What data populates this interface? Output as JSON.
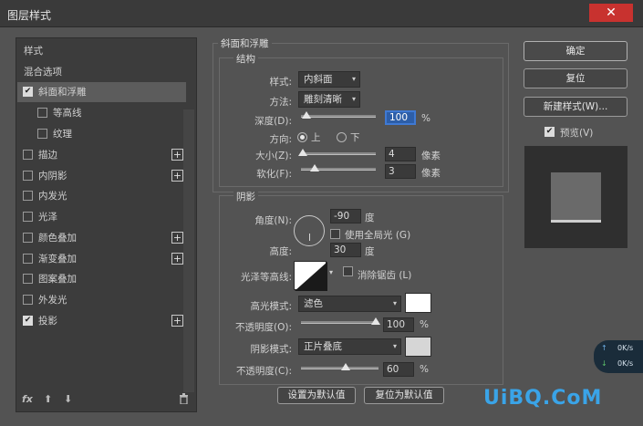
{
  "window": {
    "title": "图层样式",
    "close_glyph": "✕"
  },
  "left_panel": {
    "items": [
      {
        "label": "样式"
      },
      {
        "label": "混合选项"
      },
      {
        "label": "斜面和浮雕",
        "checked": true,
        "selected": true
      },
      {
        "label": "等高线",
        "checked": false
      },
      {
        "label": "纹理",
        "checked": false
      },
      {
        "label": "描边",
        "checked": false,
        "plus": "+"
      },
      {
        "label": "内阴影",
        "checked": false,
        "plus": "+"
      },
      {
        "label": "内发光",
        "checked": false
      },
      {
        "label": "光泽",
        "checked": false
      },
      {
        "label": "颜色叠加",
        "checked": false,
        "plus": "+"
      },
      {
        "label": "渐变叠加",
        "checked": false,
        "plus": "+"
      },
      {
        "label": "图案叠加",
        "checked": false
      },
      {
        "label": "外发光",
        "checked": false
      },
      {
        "label": "投影",
        "checked": true,
        "plus": "+"
      }
    ],
    "check_glyph": "✔",
    "fx_label": "fx",
    "up_glyph": "⬆",
    "down_glyph": "⬇",
    "trash_icon": "trash-icon"
  },
  "bevel": {
    "group_title": "斜面和浮雕",
    "structure_title": "结构",
    "style_label": "样式:",
    "style_value": "内斜面",
    "technique_label": "方法:",
    "technique_value": "雕刻清晰",
    "depth_label": "深度(D):",
    "depth_value": "100",
    "depth_pct": 1.0,
    "depth_unit": "%",
    "direction_label": "方向:",
    "direction_up": "上",
    "direction_down": "下",
    "size_label": "大小(Z):",
    "size_value": "4",
    "size_unit": "像素",
    "soften_label": "软化(F):",
    "soften_value": "3",
    "soften_unit": "像素"
  },
  "shading": {
    "title": "阴影",
    "angle_label": "角度(N):",
    "angle_value": "-90",
    "angle_unit": "度",
    "global_light_label": "使用全局光 (G)",
    "altitude_label": "高度:",
    "altitude_value": "30",
    "altitude_unit": "度",
    "gloss_label": "光泽等高线:",
    "antialias_label": "消除锯齿 (L)",
    "highlight_mode_label": "高光模式:",
    "highlight_mode_value": "滤色",
    "highlight_color": "#ffffff",
    "highlight_opacity_label": "不透明度(O):",
    "highlight_opacity_value": "100",
    "highlight_opacity_unit": "%",
    "shadow_mode_label": "阴影模式:",
    "shadow_mode_value": "正片叠底",
    "shadow_color": "#d6d6d6",
    "shadow_opacity_label": "不透明度(C):",
    "shadow_opacity_value": "60",
    "shadow_opacity_unit": "%"
  },
  "footer": {
    "set_default": "设置为默认值",
    "reset_default": "复位为默认值"
  },
  "right_panel": {
    "ok": "确定",
    "reset": "复位",
    "new_style": "新建样式(W)...",
    "preview_label": "预览(V)"
  },
  "overlay": {
    "up_speed": "0K/s",
    "down_speed": "0K/s",
    "watermark": "UiBQ.CoM"
  }
}
